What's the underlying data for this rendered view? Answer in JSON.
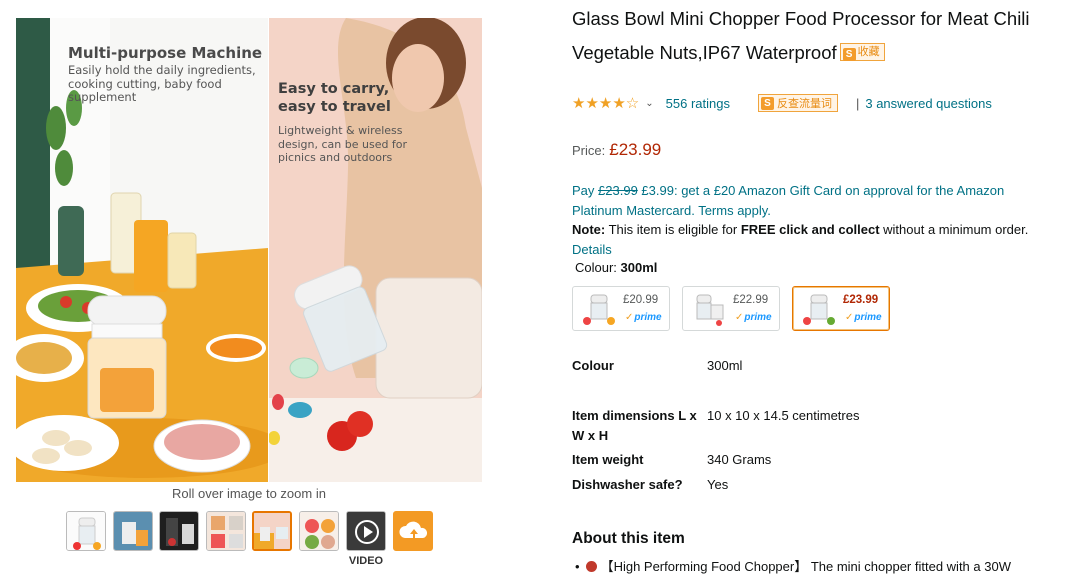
{
  "gallery": {
    "main_image": {
      "panel_left_heading": "Multi-purpose Machine",
      "panel_left_text": "Easily hold the daily ingredients, cooking cutting, baby food supplement",
      "panel_right_heading": "Easy to carry, easy to travel",
      "panel_right_text": "Lightweight & wireless design, can be used for picnics and outdoors"
    },
    "zoom_hint": "Roll over image to zoom in",
    "thumbnail_count": 8,
    "selected_thumbnail": 5,
    "video_label": "VIDEO"
  },
  "product": {
    "title": "Glass Bowl Mini Chopper Food Processor for Meat Chili Vegetable Nuts,IP67 Waterproof",
    "collect_badge": "收藏",
    "collect_badge_icon": "S",
    "rating": {
      "stars": 4.0,
      "stars_display": "★★★★☆",
      "ratings_text": "556 ratings",
      "search_badge": "反查流量词",
      "answered": "3 answered questions"
    },
    "price_label": "Price:",
    "price": "£23.99",
    "offer": {
      "pay": "Pay",
      "old_price": "£23.99",
      "new_price": "£3.99",
      "text": ": get a £20 Amazon Gift Card on approval for the Amazon Platinum Mastercard. Terms apply."
    },
    "note": {
      "label": "Note:",
      "text_1": " This item is eligible for ",
      "bold": "FREE click and collect",
      "text_2": " without a minimum order.",
      "details_link": "Details"
    },
    "colour_label": "Colour:",
    "colour_value": "300ml",
    "variants": [
      {
        "price": "£20.99",
        "prime": "prime",
        "selected": false
      },
      {
        "price": "£22.99",
        "prime": "prime",
        "selected": false
      },
      {
        "price": "£23.99",
        "prime": "prime",
        "selected": true
      }
    ]
  },
  "specs": [
    {
      "key": "Colour",
      "value": "300ml"
    },
    {
      "key": "Item dimensions L x W x H",
      "value": "10 x 10 x 14.5 centimetres"
    },
    {
      "key": "Item weight",
      "value": "340 Grams"
    },
    {
      "key": "Dishwasher safe?",
      "value": "Yes"
    }
  ],
  "about": {
    "heading": "About this item",
    "bullet_1": "【High Performing Food Chopper】 The mini chopper fitted with a 30W"
  },
  "colors": {
    "link": "#007185",
    "price": "#b12704",
    "star": "#f0a125",
    "selected_border": "#e77600"
  }
}
